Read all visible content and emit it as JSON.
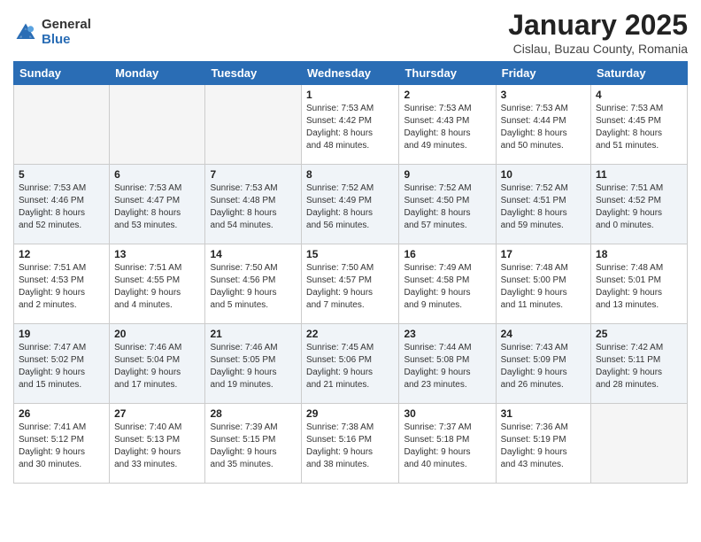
{
  "header": {
    "logo_general": "General",
    "logo_blue": "Blue",
    "month": "January 2025",
    "location": "Cislau, Buzau County, Romania"
  },
  "days_of_week": [
    "Sunday",
    "Monday",
    "Tuesday",
    "Wednesday",
    "Thursday",
    "Friday",
    "Saturday"
  ],
  "weeks": [
    [
      {
        "day": "",
        "info": ""
      },
      {
        "day": "",
        "info": ""
      },
      {
        "day": "",
        "info": ""
      },
      {
        "day": "1",
        "info": "Sunrise: 7:53 AM\nSunset: 4:42 PM\nDaylight: 8 hours\nand 48 minutes."
      },
      {
        "day": "2",
        "info": "Sunrise: 7:53 AM\nSunset: 4:43 PM\nDaylight: 8 hours\nand 49 minutes."
      },
      {
        "day": "3",
        "info": "Sunrise: 7:53 AM\nSunset: 4:44 PM\nDaylight: 8 hours\nand 50 minutes."
      },
      {
        "day": "4",
        "info": "Sunrise: 7:53 AM\nSunset: 4:45 PM\nDaylight: 8 hours\nand 51 minutes."
      }
    ],
    [
      {
        "day": "5",
        "info": "Sunrise: 7:53 AM\nSunset: 4:46 PM\nDaylight: 8 hours\nand 52 minutes."
      },
      {
        "day": "6",
        "info": "Sunrise: 7:53 AM\nSunset: 4:47 PM\nDaylight: 8 hours\nand 53 minutes."
      },
      {
        "day": "7",
        "info": "Sunrise: 7:53 AM\nSunset: 4:48 PM\nDaylight: 8 hours\nand 54 minutes."
      },
      {
        "day": "8",
        "info": "Sunrise: 7:52 AM\nSunset: 4:49 PM\nDaylight: 8 hours\nand 56 minutes."
      },
      {
        "day": "9",
        "info": "Sunrise: 7:52 AM\nSunset: 4:50 PM\nDaylight: 8 hours\nand 57 minutes."
      },
      {
        "day": "10",
        "info": "Sunrise: 7:52 AM\nSunset: 4:51 PM\nDaylight: 8 hours\nand 59 minutes."
      },
      {
        "day": "11",
        "info": "Sunrise: 7:51 AM\nSunset: 4:52 PM\nDaylight: 9 hours\nand 0 minutes."
      }
    ],
    [
      {
        "day": "12",
        "info": "Sunrise: 7:51 AM\nSunset: 4:53 PM\nDaylight: 9 hours\nand 2 minutes."
      },
      {
        "day": "13",
        "info": "Sunrise: 7:51 AM\nSunset: 4:55 PM\nDaylight: 9 hours\nand 4 minutes."
      },
      {
        "day": "14",
        "info": "Sunrise: 7:50 AM\nSunset: 4:56 PM\nDaylight: 9 hours\nand 5 minutes."
      },
      {
        "day": "15",
        "info": "Sunrise: 7:50 AM\nSunset: 4:57 PM\nDaylight: 9 hours\nand 7 minutes."
      },
      {
        "day": "16",
        "info": "Sunrise: 7:49 AM\nSunset: 4:58 PM\nDaylight: 9 hours\nand 9 minutes."
      },
      {
        "day": "17",
        "info": "Sunrise: 7:48 AM\nSunset: 5:00 PM\nDaylight: 9 hours\nand 11 minutes."
      },
      {
        "day": "18",
        "info": "Sunrise: 7:48 AM\nSunset: 5:01 PM\nDaylight: 9 hours\nand 13 minutes."
      }
    ],
    [
      {
        "day": "19",
        "info": "Sunrise: 7:47 AM\nSunset: 5:02 PM\nDaylight: 9 hours\nand 15 minutes."
      },
      {
        "day": "20",
        "info": "Sunrise: 7:46 AM\nSunset: 5:04 PM\nDaylight: 9 hours\nand 17 minutes."
      },
      {
        "day": "21",
        "info": "Sunrise: 7:46 AM\nSunset: 5:05 PM\nDaylight: 9 hours\nand 19 minutes."
      },
      {
        "day": "22",
        "info": "Sunrise: 7:45 AM\nSunset: 5:06 PM\nDaylight: 9 hours\nand 21 minutes."
      },
      {
        "day": "23",
        "info": "Sunrise: 7:44 AM\nSunset: 5:08 PM\nDaylight: 9 hours\nand 23 minutes."
      },
      {
        "day": "24",
        "info": "Sunrise: 7:43 AM\nSunset: 5:09 PM\nDaylight: 9 hours\nand 26 minutes."
      },
      {
        "day": "25",
        "info": "Sunrise: 7:42 AM\nSunset: 5:11 PM\nDaylight: 9 hours\nand 28 minutes."
      }
    ],
    [
      {
        "day": "26",
        "info": "Sunrise: 7:41 AM\nSunset: 5:12 PM\nDaylight: 9 hours\nand 30 minutes."
      },
      {
        "day": "27",
        "info": "Sunrise: 7:40 AM\nSunset: 5:13 PM\nDaylight: 9 hours\nand 33 minutes."
      },
      {
        "day": "28",
        "info": "Sunrise: 7:39 AM\nSunset: 5:15 PM\nDaylight: 9 hours\nand 35 minutes."
      },
      {
        "day": "29",
        "info": "Sunrise: 7:38 AM\nSunset: 5:16 PM\nDaylight: 9 hours\nand 38 minutes."
      },
      {
        "day": "30",
        "info": "Sunrise: 7:37 AM\nSunset: 5:18 PM\nDaylight: 9 hours\nand 40 minutes."
      },
      {
        "day": "31",
        "info": "Sunrise: 7:36 AM\nSunset: 5:19 PM\nDaylight: 9 hours\nand 43 minutes."
      },
      {
        "day": "",
        "info": ""
      }
    ]
  ]
}
